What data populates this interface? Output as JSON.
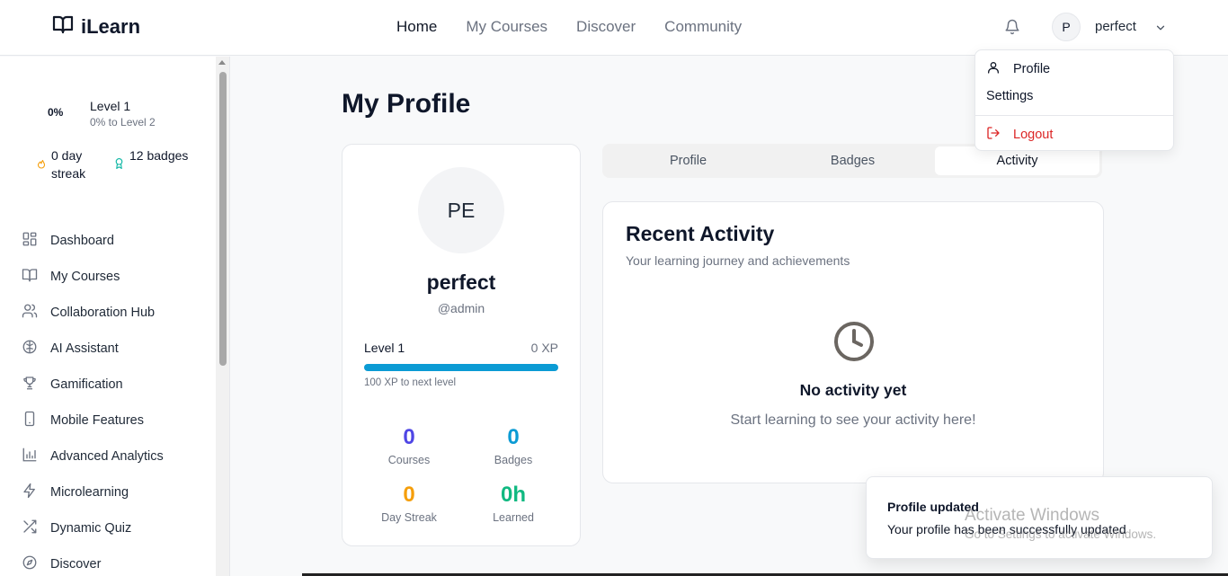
{
  "header": {
    "logo_text": "iLearn",
    "nav": [
      "Home",
      "My Courses",
      "Discover",
      "Community"
    ],
    "active_nav": "Home",
    "avatar_initial": "P",
    "username": "perfect"
  },
  "sidebar": {
    "level_percent": "0%",
    "level_title": "Level 1",
    "level_sub": "0% to Level 2",
    "streak": "0 day streak",
    "badges": "12 badges",
    "items": [
      {
        "label": "Dashboard",
        "icon": "dashboard-icon"
      },
      {
        "label": "My Courses",
        "icon": "book-icon"
      },
      {
        "label": "Collaboration Hub",
        "icon": "users-icon"
      },
      {
        "label": "AI Assistant",
        "icon": "brain-icon"
      },
      {
        "label": "Gamification",
        "icon": "trophy-icon"
      },
      {
        "label": "Mobile Features",
        "icon": "smartphone-icon"
      },
      {
        "label": "Advanced Analytics",
        "icon": "bar-chart-icon"
      },
      {
        "label": "Microlearning",
        "icon": "zap-icon"
      },
      {
        "label": "Dynamic Quiz",
        "icon": "shuffle-icon"
      },
      {
        "label": "Discover",
        "icon": "compass-icon"
      }
    ]
  },
  "main": {
    "title": "My Profile",
    "profile_card": {
      "initials": "PE",
      "name": "perfect",
      "handle": "@admin",
      "level": "Level 1",
      "xp": "0 XP",
      "xp_progress": 1.0,
      "next_level": "100 XP to next level",
      "stats": [
        {
          "value": "0",
          "label": "Courses",
          "color": "#4f46e5"
        },
        {
          "value": "0",
          "label": "Badges",
          "color": "#0b9bd4"
        },
        {
          "value": "0",
          "label": "Day Streak",
          "color": "#f59e0b"
        },
        {
          "value": "0h",
          "label": "Learned",
          "color": "#10b981"
        }
      ]
    },
    "tabs": [
      "Profile",
      "Badges",
      "Activity"
    ],
    "active_tab": "Activity",
    "activity": {
      "title": "Recent Activity",
      "subtitle": "Your learning journey and achievements",
      "empty_title": "No activity yet",
      "empty_sub": "Start learning to see your activity here!"
    }
  },
  "dropdown": {
    "profile": "Profile",
    "settings": "Settings",
    "logout": "Logout"
  },
  "toast": {
    "title": "Profile updated",
    "message": "Your profile has been successfully updated"
  },
  "watermark": {
    "line1": "Activate Windows",
    "line2": "Go to Settings to activate Windows."
  }
}
